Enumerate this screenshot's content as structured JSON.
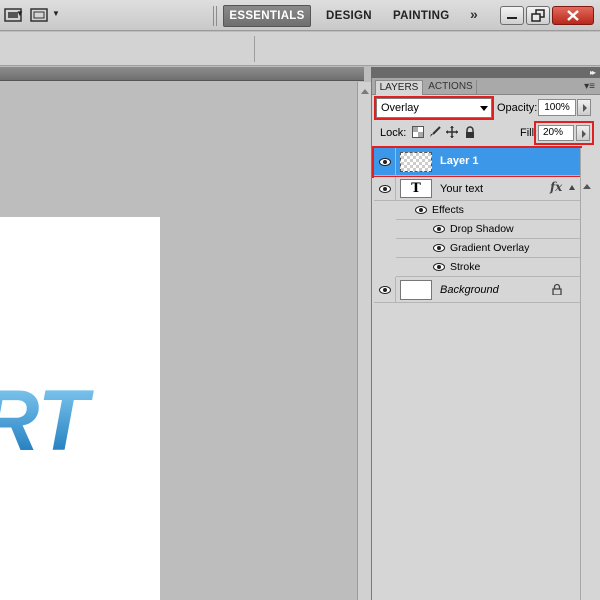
{
  "workspace": {
    "essentials": "ESSENTIALS",
    "design": "DESIGN",
    "painting": "PAINTING",
    "more": "»"
  },
  "canvas_text": "RT",
  "panel": {
    "tabs": [
      "LAYERS",
      "ACTIONS"
    ],
    "menu_icon": "panel-menu-icon",
    "blend_mode": "Overlay",
    "opacity_label": "Opacity:",
    "opacity_value": "100%",
    "lock_label": "Lock:",
    "fill_label": "Fill:",
    "fill_value": "20%"
  },
  "layers": [
    {
      "name": "Layer 1",
      "selected": true,
      "type": "pixel"
    },
    {
      "name": "Your text",
      "selected": false,
      "type": "text",
      "thumb_glyph": "T",
      "effects_label": "Effects",
      "effects": [
        "Drop Shadow",
        "Gradient Overlay",
        "Stroke"
      ]
    },
    {
      "name": "Background",
      "selected": false,
      "type": "background",
      "locked": true
    }
  ],
  "colors": {
    "selection": "#3d97e8",
    "highlight_outline": "#e02020",
    "text_gradient_top": "#8fd3f7",
    "text_gradient_bottom": "#0e6fb5"
  }
}
